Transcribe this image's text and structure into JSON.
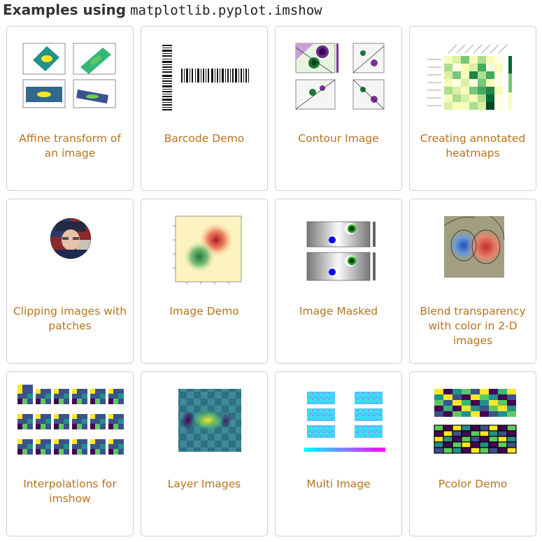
{
  "heading": {
    "text": "Examples using",
    "code": "matplotlib.pyplot.imshow"
  },
  "cards": [
    {
      "title": "Affine transform of an image"
    },
    {
      "title": "Barcode Demo"
    },
    {
      "title": "Contour Image"
    },
    {
      "title": "Creating annotated heatmaps"
    },
    {
      "title": "Clipping images with patches"
    },
    {
      "title": "Image Demo"
    },
    {
      "title": "Image Masked"
    },
    {
      "title": "Blend transparency with color in 2-D images"
    },
    {
      "title": "Interpolations for imshow"
    },
    {
      "title": "Layer Images"
    },
    {
      "title": "Multi Image"
    },
    {
      "title": "Pcolor Demo"
    }
  ],
  "colors": {
    "link": "#b8731c",
    "border": "#cfcfcf",
    "heading": "#333333"
  }
}
